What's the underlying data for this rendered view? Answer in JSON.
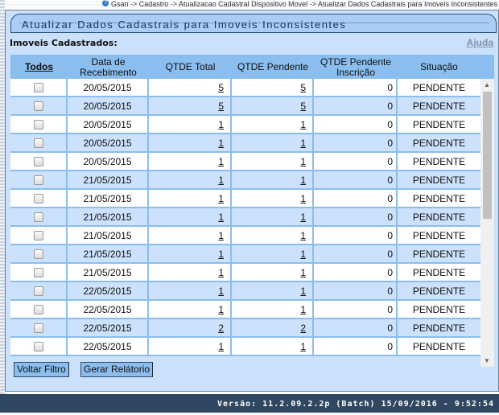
{
  "breadcrumb": "Gsan -> Cadastro -> Atualizacao Cadastral Dispositivo Movel -> Atualizar Dados Cadastrais para Imoveis Inconsistentes",
  "title": "Atualizar Dados Cadastrais para Imoveis Inconsistentes",
  "section_label": "Imoveis Cadastrados:",
  "help_link": "Ajuda",
  "columns": {
    "todos": "Todos",
    "data": "Data de Recebimento",
    "total": "QTDE Total",
    "pendente": "QTDE Pendente",
    "inscricao": "QTDE Pendente Inscrição",
    "situacao": "Situação"
  },
  "rows": [
    {
      "data": "20/05/2015",
      "total": "5",
      "pendente": "5",
      "inscricao": "0",
      "situacao": "PENDENTE"
    },
    {
      "data": "20/05/2015",
      "total": "5",
      "pendente": "5",
      "inscricao": "0",
      "situacao": "PENDENTE"
    },
    {
      "data": "20/05/2015",
      "total": "1",
      "pendente": "1",
      "inscricao": "0",
      "situacao": "PENDENTE"
    },
    {
      "data": "20/05/2015",
      "total": "1",
      "pendente": "1",
      "inscricao": "0",
      "situacao": "PENDENTE"
    },
    {
      "data": "20/05/2015",
      "total": "1",
      "pendente": "1",
      "inscricao": "0",
      "situacao": "PENDENTE"
    },
    {
      "data": "21/05/2015",
      "total": "1",
      "pendente": "1",
      "inscricao": "0",
      "situacao": "PENDENTE"
    },
    {
      "data": "21/05/2015",
      "total": "1",
      "pendente": "1",
      "inscricao": "0",
      "situacao": "PENDENTE"
    },
    {
      "data": "21/05/2015",
      "total": "1",
      "pendente": "1",
      "inscricao": "0",
      "situacao": "PENDENTE"
    },
    {
      "data": "21/05/2015",
      "total": "1",
      "pendente": "1",
      "inscricao": "0",
      "situacao": "PENDENTE"
    },
    {
      "data": "21/05/2015",
      "total": "1",
      "pendente": "1",
      "inscricao": "0",
      "situacao": "PENDENTE"
    },
    {
      "data": "21/05/2015",
      "total": "1",
      "pendente": "1",
      "inscricao": "0",
      "situacao": "PENDENTE"
    },
    {
      "data": "22/05/2015",
      "total": "1",
      "pendente": "1",
      "inscricao": "0",
      "situacao": "PENDENTE"
    },
    {
      "data": "22/05/2015",
      "total": "1",
      "pendente": "1",
      "inscricao": "0",
      "situacao": "PENDENTE"
    },
    {
      "data": "22/05/2015",
      "total": "2",
      "pendente": "2",
      "inscricao": "0",
      "situacao": "PENDENTE"
    },
    {
      "data": "22/05/2015",
      "total": "1",
      "pendente": "1",
      "inscricao": "0",
      "situacao": "PENDENTE"
    }
  ],
  "buttons": {
    "voltar": "Voltar Filtro",
    "gerar": "Gerar Relátorio"
  },
  "footer": "Versão: 11.2.09.2.2p (Batch) 15/09/2016 - 9:52:54"
}
